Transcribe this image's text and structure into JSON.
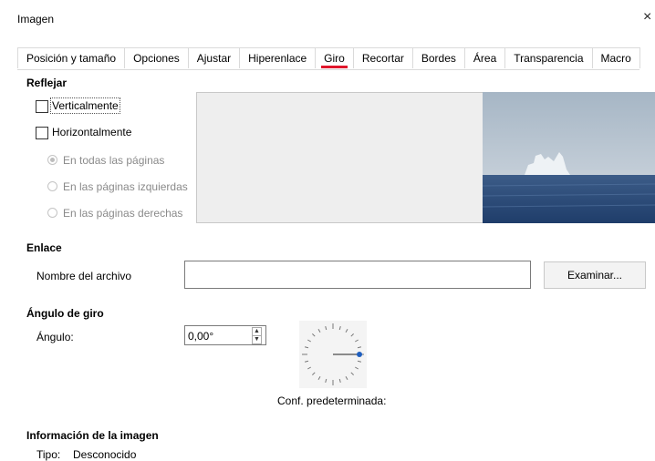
{
  "window": {
    "title": "Imagen",
    "close_icon": "×"
  },
  "tabs": [
    {
      "label": "Posición y tamaño"
    },
    {
      "label": "Opciones"
    },
    {
      "label": "Ajustar"
    },
    {
      "label": "Hiperenlace"
    },
    {
      "label": "Giro",
      "active": true
    },
    {
      "label": "Recortar"
    },
    {
      "label": "Bordes"
    },
    {
      "label": "Área"
    },
    {
      "label": "Transparencia"
    },
    {
      "label": "Macro"
    }
  ],
  "mirror": {
    "heading": "Reflejar",
    "vertical": {
      "label": "Verticalmente",
      "checked": false
    },
    "horizontal": {
      "label": "Horizontalmente",
      "checked": false
    },
    "all_pages": {
      "label": "En todas las páginas",
      "selected": true
    },
    "left_pages": {
      "label": "En las páginas izquierdas",
      "selected": false
    },
    "right_pages": {
      "label": "En las páginas derechas",
      "selected": false
    }
  },
  "link": {
    "heading": "Enlace",
    "filename_label": "Nombre del archivo",
    "filename_value": "",
    "browse_button": "Examinar..."
  },
  "rotation": {
    "heading": "Ángulo de giro",
    "angle_label": "Ángulo:",
    "angle_value": "0,00°",
    "default_label": "Conf. predeterminada:",
    "angle_degrees": 0
  },
  "image_info": {
    "heading": "Información de la imagen",
    "type_label": "Tipo:",
    "type_value": "Desconocido"
  },
  "colors": {
    "accent": "#e0162b",
    "dial_handle": "#1f5fbf"
  }
}
